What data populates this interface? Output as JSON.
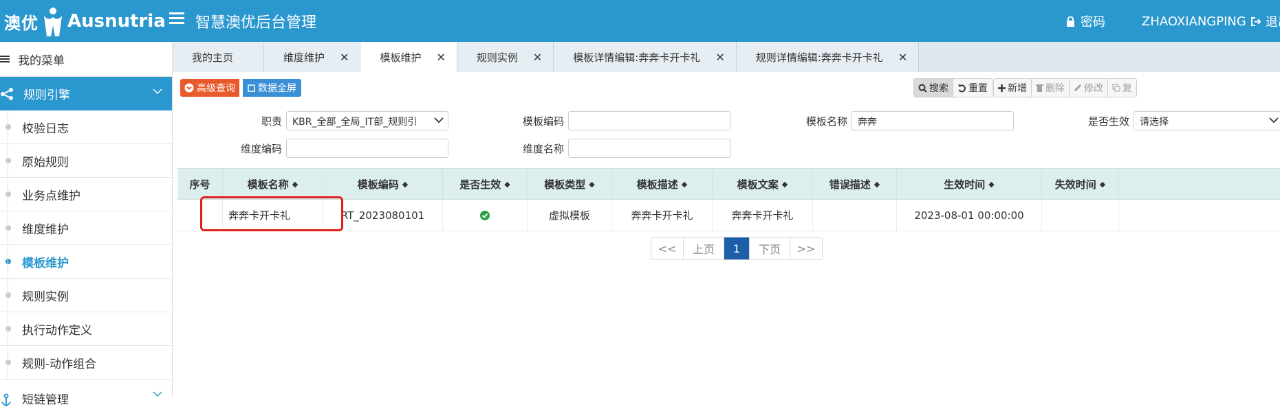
{
  "header": {
    "logo_cn": "澳优",
    "logo_en": "Ausnutria",
    "app_title": "智慧澳优后台管理",
    "password_label": "密码",
    "username": "ZHAOXIANGPING",
    "logout_label": "退出"
  },
  "sidebar": {
    "my_menu_label": "我的菜单",
    "group_label": "规则引擎",
    "items": [
      {
        "label": "校验日志"
      },
      {
        "label": "原始规则"
      },
      {
        "label": "业务点维护"
      },
      {
        "label": "维度维护"
      },
      {
        "label": "模板维护"
      },
      {
        "label": "规则实例"
      },
      {
        "label": "执行动作定义"
      },
      {
        "label": "规则-动作组合"
      }
    ],
    "active_item": "模板维护",
    "group2_label": "短链管理"
  },
  "tabs": [
    {
      "label": "我的主页"
    },
    {
      "label": "维度维护"
    },
    {
      "label": "模板维护"
    },
    {
      "label": "规则实例"
    },
    {
      "label": "模板详情编辑:奔奔卡开卡礼"
    },
    {
      "label": "规则详情编辑:奔奔卡开卡礼"
    }
  ],
  "active_tab": "模板维护",
  "toolbar": {
    "advanced_query": "高级查询",
    "data_fullscreen": "数据全屏",
    "search": "搜索",
    "reset": "重置",
    "add": "新增",
    "delete": "删除",
    "edit": "修改",
    "copy": "复"
  },
  "filters": {
    "duty_label": "职责",
    "duty_value": "KBR_全部_全局_IT部_规则引",
    "template_code_label": "模板编码",
    "template_code_value": "",
    "template_name_label": "模板名称",
    "template_name_value": "奔奔",
    "is_active_label": "是否生效",
    "is_active_value": "请选择",
    "dimension_code_label": "维度编码",
    "dimension_code_value": "",
    "dimension_name_label": "维度名称",
    "dimension_name_value": ""
  },
  "table": {
    "columns": [
      "序号",
      "模板名称",
      "模板编码",
      "是否生效",
      "模板类型",
      "模板描述",
      "模板文案",
      "错误描述",
      "生效时间",
      "失效时间"
    ],
    "rows": [
      {
        "index": "",
        "name": "奔奔卡开卡礼",
        "code": "RT_2023080101",
        "active": true,
        "type": "虚拟模板",
        "desc": "奔奔卡开卡礼",
        "copy": "奔奔卡开卡礼",
        "error": "",
        "start": "2023-08-01 00:00:00",
        "end": ""
      }
    ]
  },
  "pagination": {
    "first": "<<",
    "prev": "上页",
    "current": "1",
    "next": "下页",
    "last": ">>"
  },
  "colors": {
    "header_blue": "#2b97cf",
    "accent_orange": "#e85a2c",
    "highlight_red": "#e11f1f",
    "current_page": "#1e5ea9",
    "active_check": "#2aa040"
  }
}
